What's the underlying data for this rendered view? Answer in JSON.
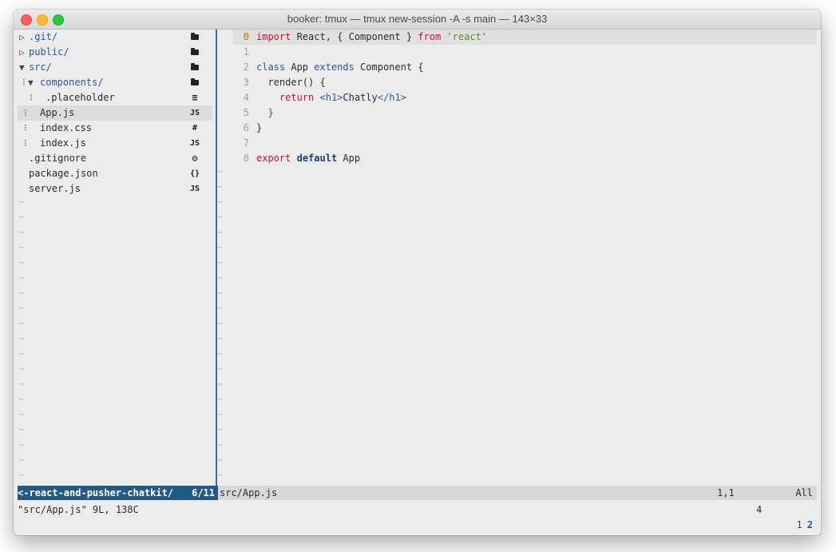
{
  "window": {
    "title": "booker: tmux — tmux new-session -A -s main — 143×33"
  },
  "tree": {
    "items": [
      {
        "label": ".git/",
        "kind": "dir",
        "prefix": "▷",
        "icon": "folder-icon"
      },
      {
        "label": "public/",
        "kind": "dir",
        "prefix": "▷",
        "icon": "folder-icon"
      },
      {
        "label": "src/",
        "kind": "dir",
        "prefix": "▼",
        "icon": "folder-icon"
      },
      {
        "label": "components/",
        "kind": "dir",
        "prefix": "⁝▼",
        "icon": "folder-icon"
      },
      {
        "label": ".placeholder",
        "kind": "file",
        "prefix": "⁝",
        "icon": "lines-icon",
        "icon_text": "≡"
      },
      {
        "label": "App.js",
        "kind": "file",
        "prefix": "⁝",
        "icon": "js-icon",
        "icon_text": "JS",
        "selected": true
      },
      {
        "label": "index.css",
        "kind": "file",
        "prefix": "⁝",
        "icon": "hash-icon",
        "icon_text": "#"
      },
      {
        "label": "index.js",
        "kind": "file",
        "prefix": "⁝",
        "icon": "js-icon",
        "icon_text": "JS"
      },
      {
        "label": ".gitignore",
        "kind": "file",
        "prefix": "",
        "icon": "gear-icon",
        "icon_text": "⚙"
      },
      {
        "label": "package.json",
        "kind": "file",
        "prefix": "",
        "icon": "braces-icon",
        "icon_text": "{}"
      },
      {
        "label": "server.js",
        "kind": "file",
        "prefix": "",
        "icon": "js-icon",
        "icon_text": "JS"
      }
    ]
  },
  "editor": {
    "lines": [
      {
        "num": "0",
        "current": true,
        "tokens": [
          {
            "t": "import",
            "c": "kw"
          },
          {
            "t": " React, { Component } ",
            "c": ""
          },
          {
            "t": "from",
            "c": "kw"
          },
          {
            "t": " ",
            "c": ""
          },
          {
            "t": "'react'",
            "c": "str"
          }
        ]
      },
      {
        "num": "1",
        "tokens": []
      },
      {
        "num": "2",
        "tokens": [
          {
            "t": "class",
            "c": "kw2"
          },
          {
            "t": " App ",
            "c": ""
          },
          {
            "t": "extends",
            "c": "kw2"
          },
          {
            "t": " Component {",
            "c": ""
          }
        ]
      },
      {
        "num": "3",
        "tokens": [
          {
            "t": "  render() {",
            "c": ""
          }
        ]
      },
      {
        "num": "4",
        "tokens": [
          {
            "t": "    ",
            "c": ""
          },
          {
            "t": "return",
            "c": "kw"
          },
          {
            "t": " ",
            "c": ""
          },
          {
            "t": "<h1>",
            "c": "tag"
          },
          {
            "t": "Chatly",
            "c": ""
          },
          {
            "t": "</h1>",
            "c": "tag"
          }
        ]
      },
      {
        "num": "5",
        "tokens": [
          {
            "t": "  }",
            "c": "tag"
          }
        ]
      },
      {
        "num": "6",
        "tokens": [
          {
            "t": "}",
            "c": ""
          }
        ]
      },
      {
        "num": "7",
        "tokens": []
      },
      {
        "num": "8",
        "tokens": [
          {
            "t": "export",
            "c": "kw"
          },
          {
            "t": " ",
            "c": ""
          },
          {
            "t": "default",
            "c": "bold"
          },
          {
            "t": " App",
            "c": ""
          }
        ]
      }
    ],
    "tilde": "~"
  },
  "status": {
    "tree_path": "<-react-and-pusher-chatkit/",
    "tree_count": "6/11",
    "file": "src/App.js",
    "position": "1,1",
    "scroll": "All"
  },
  "cmdline": {
    "message": "\"src/App.js\" 9L, 138C",
    "number": "4"
  },
  "tabs": {
    "items": [
      "1",
      "2"
    ],
    "active": "2"
  },
  "colors": {
    "accent": "#235a84",
    "separator": "#2e6fa8",
    "keyword": "#c8102e",
    "string": "#5a8a2a"
  }
}
